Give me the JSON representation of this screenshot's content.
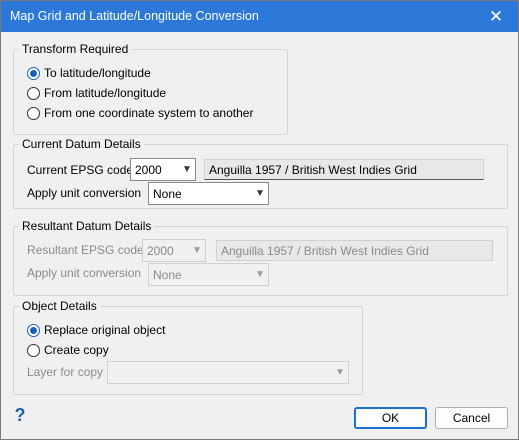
{
  "window": {
    "title": "Map Grid and Latitude/Longitude Conversion",
    "close_glyph": "✕"
  },
  "transform": {
    "legend": "Transform Required",
    "options": [
      {
        "label": "To latitude/longitude",
        "checked": true
      },
      {
        "label": "From latitude/longitude",
        "checked": false
      },
      {
        "label": "From one coordinate system to another",
        "checked": false
      }
    ]
  },
  "current": {
    "legend": "Current Datum Details",
    "epsg_label": "Current EPSG code",
    "epsg_value": "2000",
    "epsg_name": "Anguilla 1957 / British West Indies Grid",
    "unit_label": "Apply unit conversion",
    "unit_value": "None"
  },
  "resultant": {
    "legend": "Resultant Datum Details",
    "epsg_label": "Resultant EPSG code",
    "epsg_value": "2000",
    "epsg_name": "Anguilla 1957 / British West Indies Grid",
    "unit_label": "Apply unit conversion",
    "unit_value": "None"
  },
  "object": {
    "legend": "Object Details",
    "options": [
      {
        "label": "Replace original object",
        "checked": true
      },
      {
        "label": "Create copy",
        "checked": false
      }
    ],
    "layer_label": "Layer for copy",
    "layer_value": ""
  },
  "footer": {
    "help_glyph": "?",
    "ok_label": "OK",
    "cancel_label": "Cancel"
  },
  "icons": {
    "dropdown": "chevron-down-icon",
    "help": "help-icon",
    "close": "close-icon"
  },
  "colors": {
    "accent": "#1a5fb4",
    "titlebar": "#2b78d8"
  }
}
